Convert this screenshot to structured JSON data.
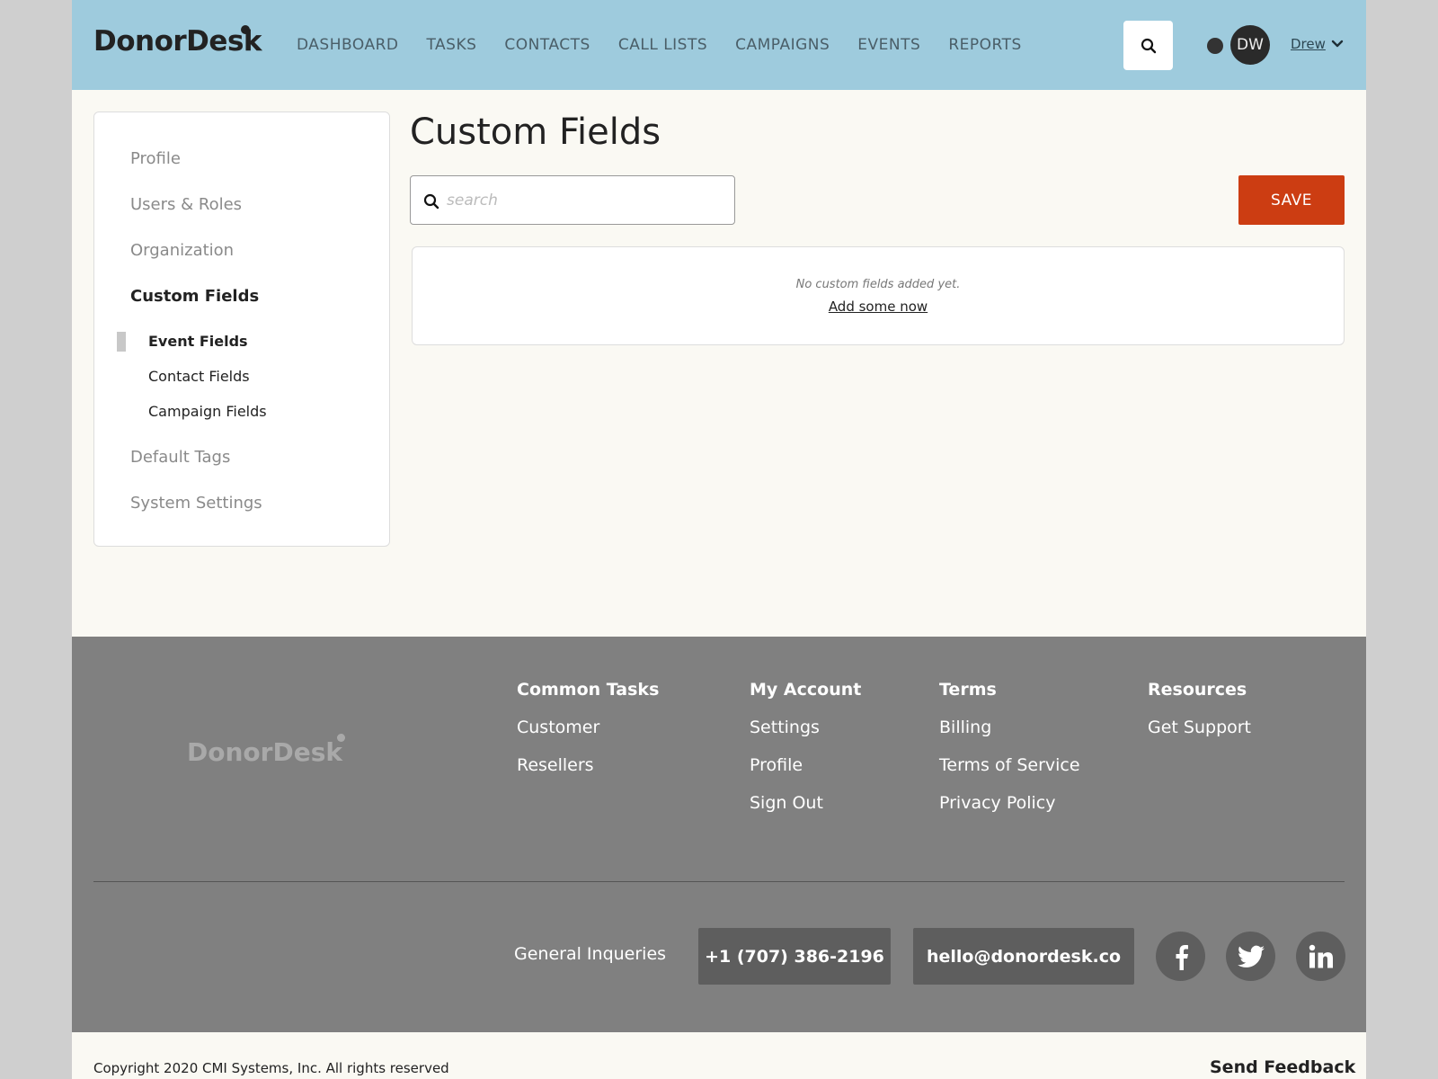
{
  "header": {
    "logo": "DonorDesk",
    "nav": [
      "DASHBOARD",
      "TASKS",
      "CONTACTS",
      "CALL LISTS",
      "CAMPAIGNS",
      "EVENTS",
      "REPORTS"
    ],
    "avatar_initials": "DW",
    "user_name": "Drew"
  },
  "sidebar": {
    "items": [
      "Profile",
      "Users & Roles",
      "Organization",
      "Custom Fields"
    ],
    "sub_items": [
      "Event Fields",
      "Contact Fields",
      "Campaign Fields"
    ],
    "bottom_items": [
      "Default Tags",
      "System Settings"
    ]
  },
  "main": {
    "title": "Custom Fields",
    "search_placeholder": "search",
    "save_label": "SAVE",
    "empty_text": "No custom fields added yet.",
    "empty_link": "Add some now"
  },
  "footer": {
    "logo": "DonorDesk",
    "columns": [
      {
        "heading": "Common Tasks",
        "links": [
          "Customer",
          "Resellers"
        ]
      },
      {
        "heading": "My Account",
        "links": [
          "Settings",
          "Profile",
          "Sign Out"
        ]
      },
      {
        "heading": "Terms",
        "links": [
          "Billing",
          "Terms of Service",
          "Privacy Policy"
        ]
      },
      {
        "heading": "Resources",
        "links": [
          "Get Support"
        ]
      }
    ],
    "inquiries_label": "General Inqueries",
    "phone": "+1 (707) 386-2196",
    "email": "hello@donordesk.co",
    "social_icons": [
      "facebook-icon",
      "twitter-icon",
      "linkedin-icon"
    ],
    "copyright": "Copyright 2020 CMI Systems, Inc. All rights reserved",
    "feedback": "Send Feedback"
  },
  "colors": {
    "header_bg": "#9ecbdd",
    "page_bg": "#faf9f3",
    "accent": "#cc3d12",
    "footer_bg": "#808080"
  }
}
